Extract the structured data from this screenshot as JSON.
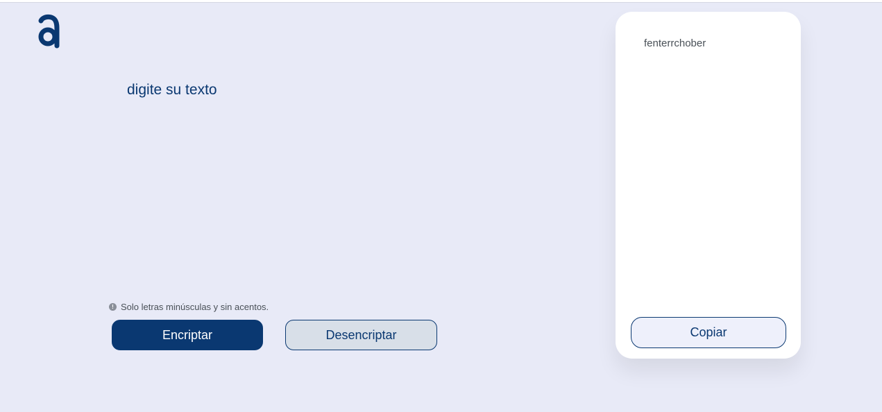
{
  "app": {
    "logo_icon": "alura-a-logo-icon",
    "accent_color": "#0a3871",
    "background_color": "#e8eaf7"
  },
  "input": {
    "placeholder": "digite su texto",
    "value": ""
  },
  "hint": {
    "icon": "info-icon",
    "icon_glyph": "!",
    "text": "Solo letras minúsculas y sin acentos."
  },
  "buttons": {
    "encrypt_label": "Encriptar",
    "decrypt_label": "Desencriptar"
  },
  "output": {
    "text": "fenterrchober",
    "copy_label": "Copiar"
  }
}
